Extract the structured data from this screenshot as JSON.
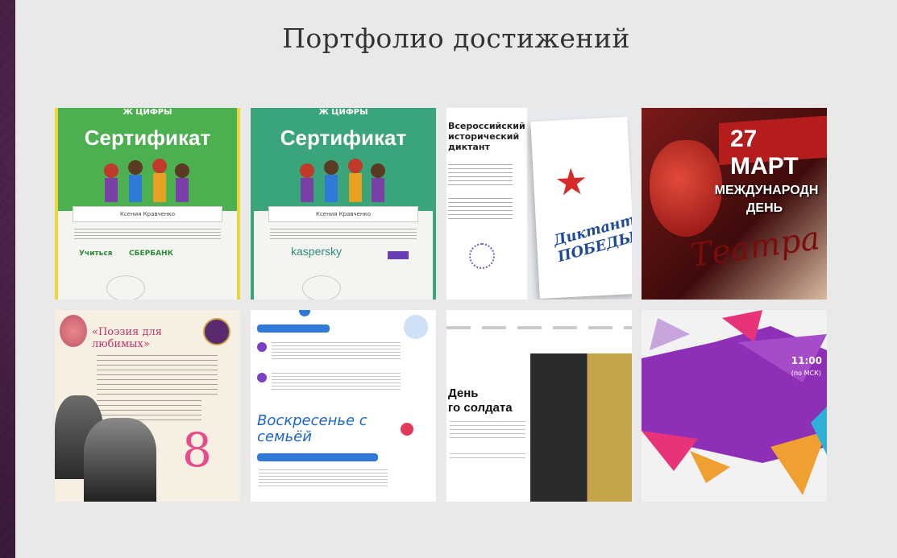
{
  "page": {
    "title": "Портфолио достижений"
  },
  "tiles": {
    "cert1": {
      "logo": "Ж ЦИФРЫ",
      "heading": "Сертификат",
      "name": "Ксения Кравченко",
      "sponsor_a": "Учиться",
      "sponsor_b": "СБЕРБАНК"
    },
    "cert2": {
      "logo": "Ж ЦИФРЫ",
      "heading": "Сертификат",
      "name": "Ксения Кравченко",
      "sponsor": "kaspersky"
    },
    "dictation": {
      "heading": "Всероссийский исторический диктант",
      "brand_line1": "Диктант",
      "brand_line2": "ПОБЕДЫ"
    },
    "theatre": {
      "date": "27 МАРТ",
      "line1": "МЕЖДУНАРОДН",
      "line2": "ДЕНЬ",
      "script": "Театра"
    },
    "poetry": {
      "heading": "«Поэзия для любимых»",
      "number": "8"
    },
    "sunday": {
      "heading": "Воскресенье с семьёй"
    },
    "soldier": {
      "heading_line1": "День",
      "heading_line2": "го солдата"
    },
    "poly": {
      "time": "11:00",
      "sub": "(по МСК)"
    }
  }
}
